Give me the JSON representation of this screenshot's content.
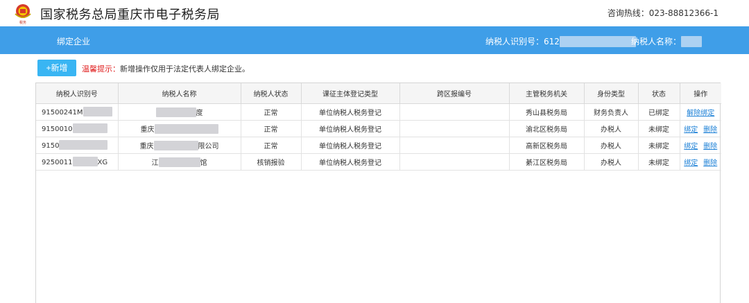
{
  "header": {
    "site_title": "国家税务总局重庆市电子税务局",
    "hotline": "咨询热线：023-88812366-1"
  },
  "nav": {
    "item": "绑定企业",
    "taxpayer_id_label": "纳税人识别号：612",
    "taxpayer_name_label": "纳税人名称："
  },
  "toolbar": {
    "add_label": "+新增",
    "tip_label": "温馨提示：",
    "tip_text": "新增操作仅用于法定代表人绑定企业。"
  },
  "table": {
    "headers": [
      "纳税人识别号",
      "纳税人名称",
      "纳税人状态",
      "课征主体登记类型",
      "跨区报编号",
      "主管税务机关",
      "身份类型",
      "状态",
      "操作"
    ],
    "rows": [
      {
        "id_prefix": "91500241M",
        "id_suffix": "",
        "name_prefix": "",
        "name_suffix": "度",
        "status": "正常",
        "reg_type": "单位纳税人税务登记",
        "cross": "",
        "authority": "秀山县税务局",
        "identity": "财务负责人",
        "state": "已绑定",
        "actions": [
          "解除绑定"
        ]
      },
      {
        "id_prefix": "9150010",
        "id_suffix": "",
        "name_prefix": "重庆",
        "name_suffix": "",
        "status": "正常",
        "reg_type": "单位纳税人税务登记",
        "cross": "",
        "authority": "渝北区税务局",
        "identity": "办税人",
        "state": "未绑定",
        "actions": [
          "绑定",
          "删除"
        ]
      },
      {
        "id_prefix": "9150",
        "id_suffix": "",
        "name_prefix": "重庆",
        "name_suffix": "限公司",
        "status": "正常",
        "reg_type": "单位纳税人税务登记",
        "cross": "",
        "authority": "高新区税务局",
        "identity": "办税人",
        "state": "未绑定",
        "actions": [
          "绑定",
          "删除"
        ]
      },
      {
        "id_prefix": "9250011",
        "id_suffix": "XG",
        "name_prefix": "江",
        "name_suffix": "馆",
        "status": "核销报验",
        "reg_type": "单位纳税人税务登记",
        "cross": "",
        "authority": "綦江区税务局",
        "identity": "办税人",
        "state": "未绑定",
        "actions": [
          "绑定",
          "删除"
        ]
      }
    ]
  },
  "colors": {
    "nav_bg": "#3f9ee8",
    "button_bg": "#39b5f3",
    "tip_label": "#e02020",
    "link": "#1a7fd6"
  },
  "icons": {
    "logo": "tax-emblem-icon"
  }
}
